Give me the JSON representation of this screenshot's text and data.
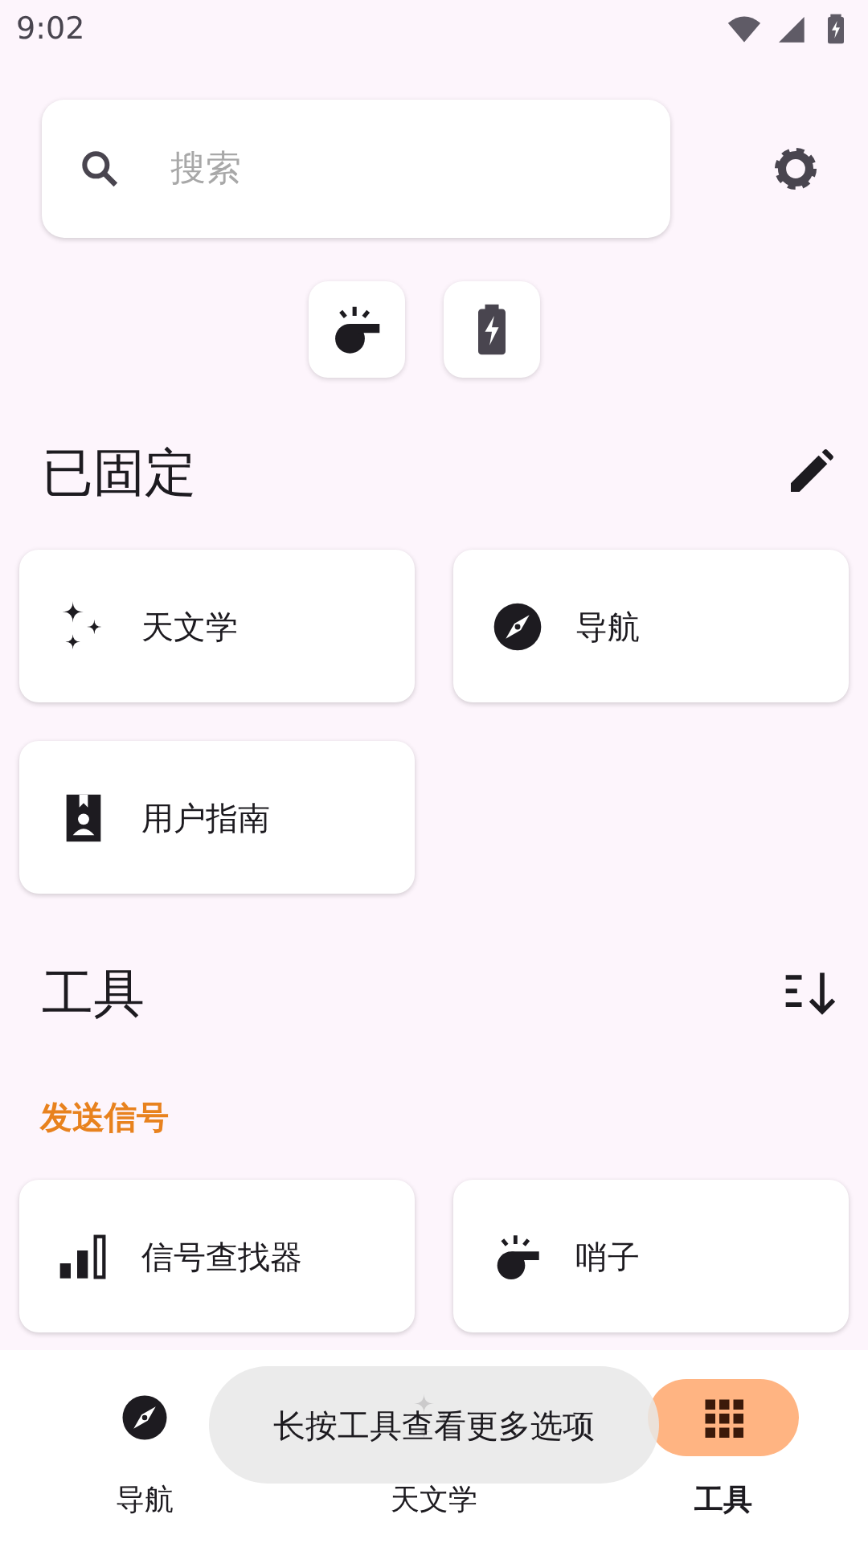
{
  "status_bar": {
    "time": "9:02"
  },
  "search": {
    "placeholder": "搜索"
  },
  "quick_actions": [
    {
      "kind": "whistle"
    },
    {
      "kind": "battery"
    }
  ],
  "pinned": {
    "title": "已固定",
    "items": [
      {
        "label": "天文学",
        "kind": "astronomy"
      },
      {
        "label": "导航",
        "kind": "navigation"
      },
      {
        "label": "用户指南",
        "kind": "guide"
      }
    ]
  },
  "tools": {
    "title": "工具",
    "groups": [
      {
        "title": "发送信号",
        "items": [
          {
            "label": "信号查找器",
            "kind": "signal"
          },
          {
            "label": "哨子",
            "kind": "whistle"
          }
        ]
      }
    ]
  },
  "bottom_nav": [
    {
      "label": "导航",
      "kind": "navigation",
      "selected": false
    },
    {
      "label": "天文学",
      "kind": "astronomy",
      "selected": false
    },
    {
      "label": "工具",
      "kind": "tools",
      "selected": true
    }
  ],
  "toast": {
    "text": "长按工具查看更多选项"
  }
}
